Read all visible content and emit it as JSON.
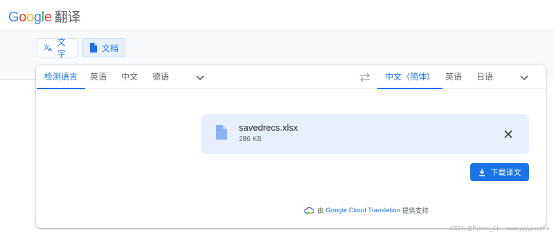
{
  "header": {
    "logo_text": "Google",
    "product_name": "翻译"
  },
  "modes": [
    {
      "label": "文字",
      "icon": "translate-icon",
      "active": false
    },
    {
      "label": "文档",
      "icon": "document-icon",
      "active": true
    }
  ],
  "source_languages": [
    {
      "label": "检测语言",
      "active": true
    },
    {
      "label": "英语",
      "active": false
    },
    {
      "label": "中文",
      "active": false
    },
    {
      "label": "德语",
      "active": false
    }
  ],
  "target_languages": [
    {
      "label": "中文（简体）",
      "active": true
    },
    {
      "label": "英语",
      "active": false
    },
    {
      "label": "日语",
      "active": false
    }
  ],
  "file": {
    "name": "savedrecs.xlsx",
    "size": "286 KB"
  },
  "download_label": "下载译文",
  "attribution": {
    "prefix": "由",
    "brand": "Google Cloud Translation",
    "suffix": "提供支持"
  },
  "watermark": "CSDN @Python_Ch... www.yyyyp.online",
  "colors": {
    "accent": "#1a73e8",
    "active_mode_bg": "#e8f0fe",
    "file_chip_bg": "#e8f0fe"
  }
}
